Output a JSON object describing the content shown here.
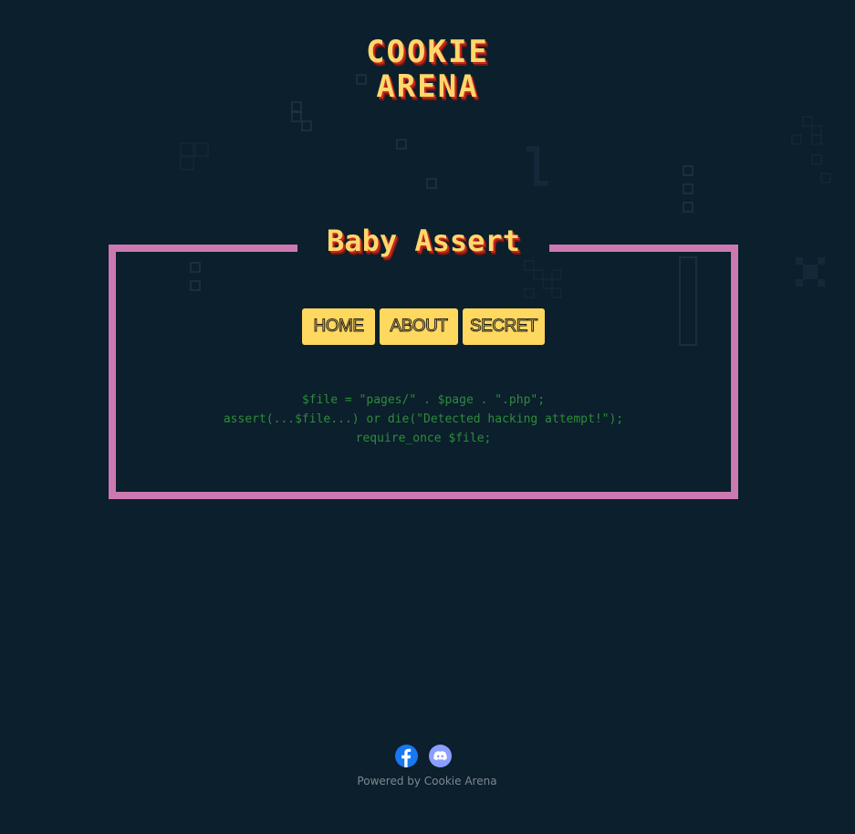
{
  "logo": {
    "line1": "COOKIE",
    "line2": "ARENA"
  },
  "challenge": {
    "title": "Baby Assert"
  },
  "nav": {
    "home": "HOME",
    "about": "ABOUT",
    "secret": "SECRET"
  },
  "code": {
    "line1": "$file = \"pages/\" . $page . \".php\";",
    "line2": "assert(...$file...) or die(\"Detected hacking attempt!\");",
    "line3": "require_once $file;"
  },
  "footer": {
    "powered_by": "Powered by Cookie Arena",
    "icons": [
      "facebook-icon",
      "discord-icon"
    ]
  },
  "colors": {
    "background": "#0b1f2c",
    "frame": "#cb79b0",
    "button": "#ffd860",
    "code": "#2e8c3a",
    "title": "#ffd86b",
    "title_shadow": "#c8281e"
  }
}
